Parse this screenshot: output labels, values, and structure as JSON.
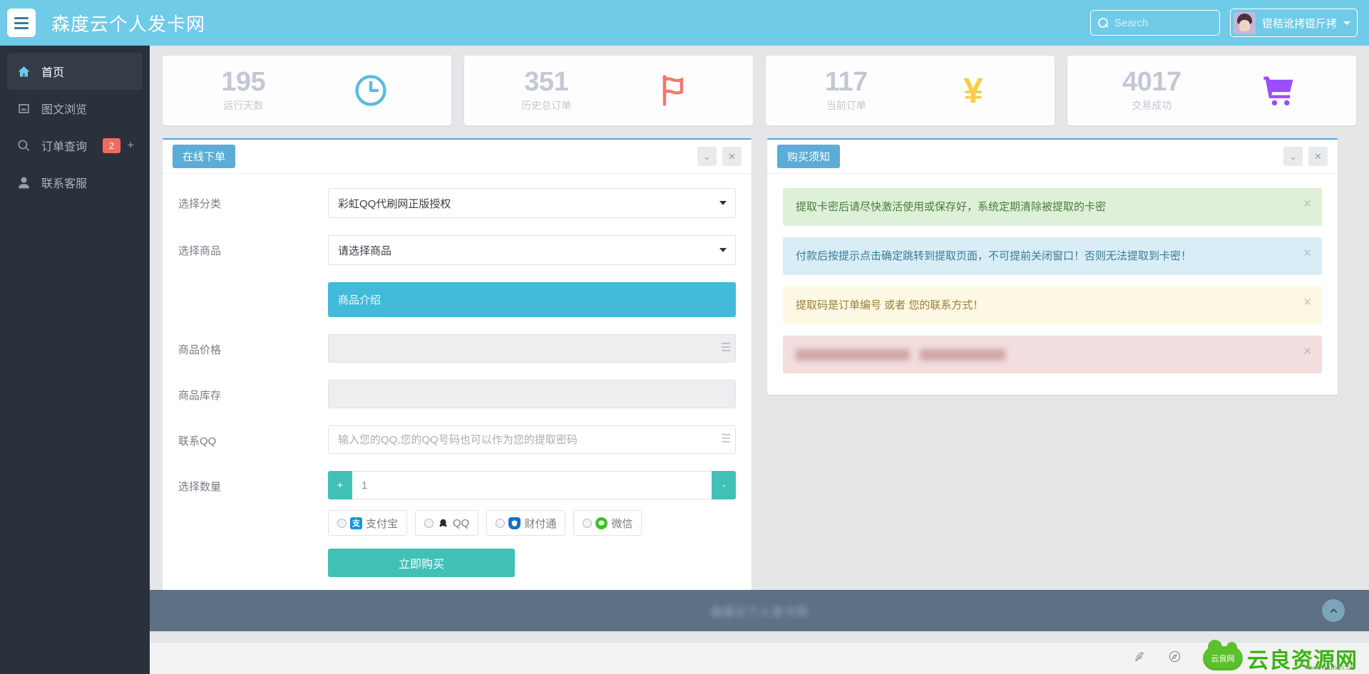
{
  "topbar": {
    "brand": "森度云个人发卡网",
    "menu_icon": "hamburger-icon",
    "search": {
      "value": "",
      "placeholder": "Search"
    },
    "user": {
      "name": "锟秸讹拷锟斤拷"
    }
  },
  "sidebar": {
    "items": [
      {
        "label": "首页",
        "icon": "home-icon",
        "active": true,
        "badge": "",
        "plus": ""
      },
      {
        "label": "图文浏览",
        "icon": "image-icon",
        "active": false,
        "badge": "",
        "plus": ""
      },
      {
        "label": "订单查询",
        "icon": "search-icon",
        "active": false,
        "badge": "2",
        "plus": "+"
      },
      {
        "label": "联系客服",
        "icon": "user-icon",
        "active": false,
        "badge": "",
        "plus": ""
      }
    ]
  },
  "stats": [
    {
      "value": "195",
      "label": "运行天数",
      "icon": "clock-icon",
      "color": "#58bbe3"
    },
    {
      "value": "351",
      "label": "历史总订单",
      "icon": "flag-icon",
      "color": "#f4776a"
    },
    {
      "value": "117",
      "label": "当前订单",
      "icon": "yen-icon",
      "color": "#f7ce46"
    },
    {
      "value": "4017",
      "label": "交易成功",
      "icon": "cart-icon",
      "color": "#9b4dfb"
    }
  ],
  "order_panel": {
    "tag": "在线下单",
    "tools": {
      "collapse": "⌄",
      "close": "✕"
    },
    "labels": {
      "category": "选择分类",
      "product": "选择商品",
      "price": "商品价格",
      "stock": "商品库存",
      "qq": "联系QQ",
      "quantity": "选择数量"
    },
    "category_value": "彩虹QQ代刷网正版授权",
    "product_value": "请选择商品",
    "intro_text": "商品介绍",
    "price_value": "",
    "stock_value": "",
    "qq_value": "",
    "qq_placeholder": "输入您的QQ,您的QQ号码也可以作为您的提取密码",
    "quantity_value": "1",
    "qty_plus": "+",
    "qty_minus": "-",
    "payments": [
      {
        "label": "支付宝",
        "glyph": "支",
        "icon": "alipay-icon"
      },
      {
        "label": "QQ",
        "glyph": "Q",
        "icon": "qq-icon"
      },
      {
        "label": "财付通",
        "glyph": "",
        "icon": "tenpay-icon"
      },
      {
        "label": "微信",
        "glyph": "",
        "icon": "wechat-icon"
      }
    ],
    "buy_button": "立即购买"
  },
  "notice_panel": {
    "tag": "购买须知",
    "tools": {
      "collapse": "⌄",
      "close": "✕"
    },
    "alerts": [
      {
        "type": "success",
        "text": "提取卡密后请尽快激活使用或保存好，系统定期清除被提取的卡密",
        "close": "✕"
      },
      {
        "type": "info",
        "text": "付款后按提示点击确定跳转到提取页面，不可提前关闭窗口！否则无法提取到卡密！",
        "close": "✕"
      },
      {
        "type": "warning",
        "text": "提取码是订单编号 或者 您的联系方式！",
        "close": "✕"
      },
      {
        "type": "danger",
        "text": "",
        "redacted": true,
        "close": "✕"
      }
    ]
  },
  "footer": {
    "text": "森度云个人发卡网",
    "to_top_icon": "chevron-up-icon"
  },
  "watermark": {
    "logo_text": "云良网",
    "name": "云良资源网",
    "url": "www.kubbs.cn",
    "strip_icons": [
      "rocket-icon",
      "compass-icon"
    ]
  }
}
